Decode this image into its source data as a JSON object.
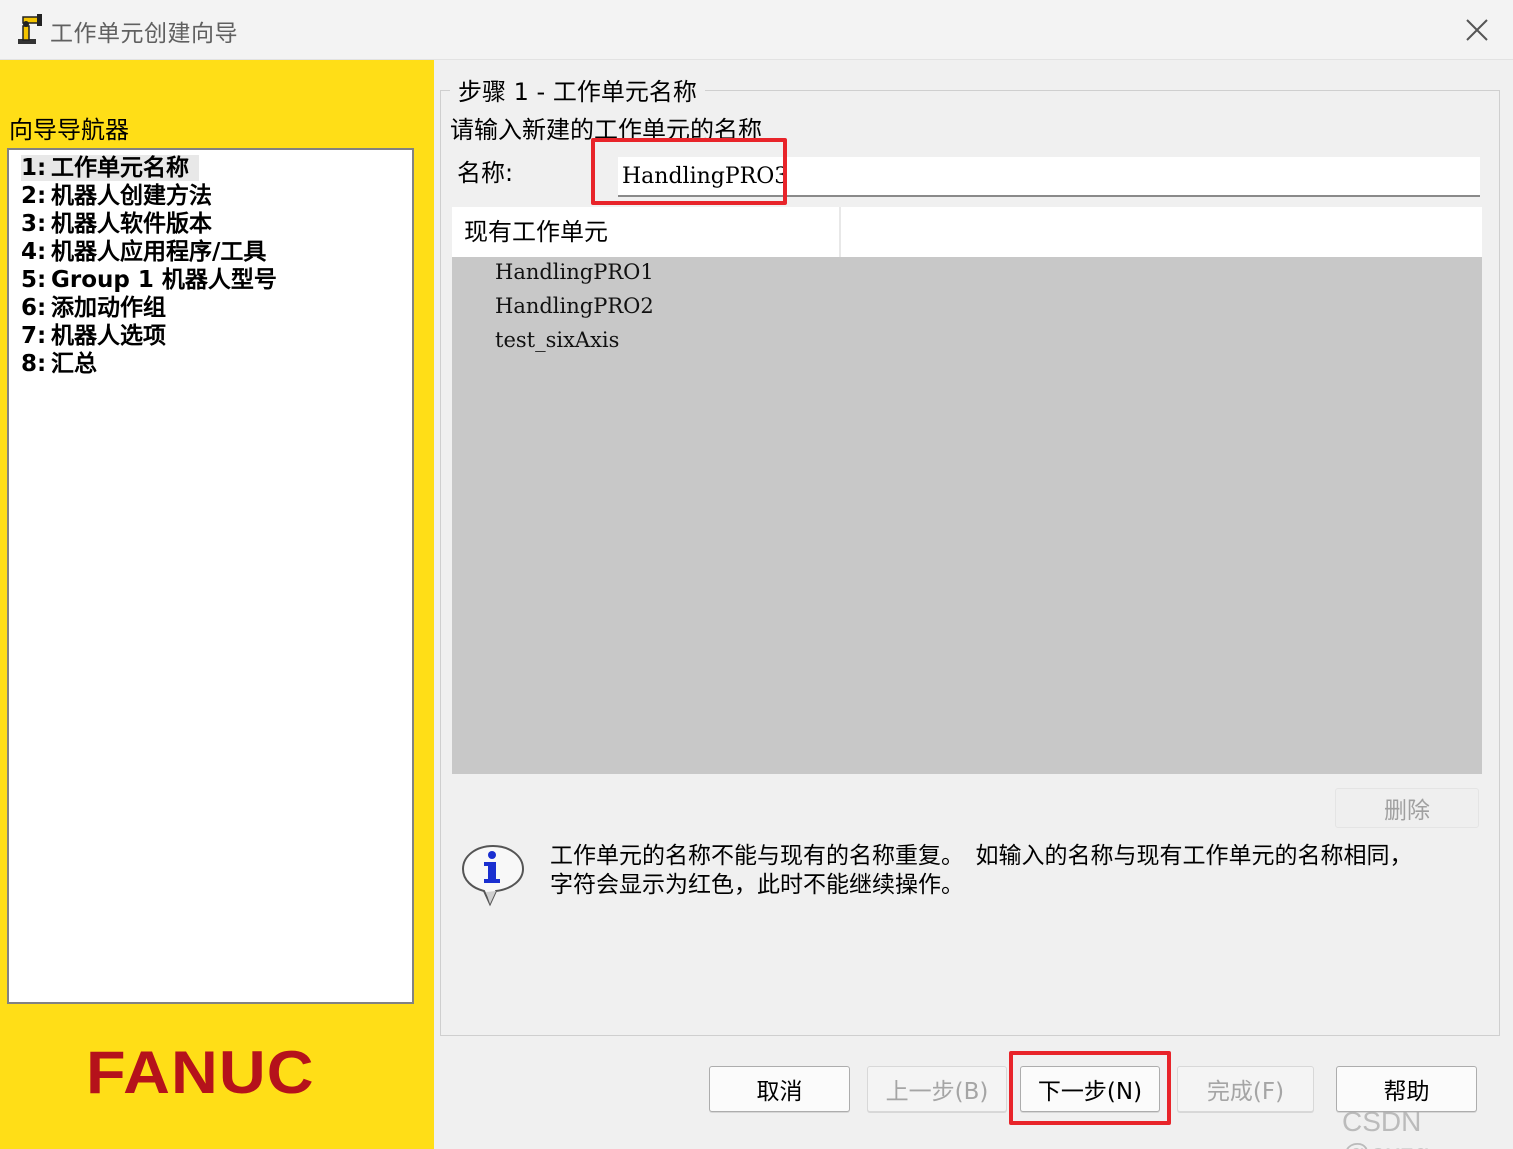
{
  "window": {
    "title": "工作单元创建向导"
  },
  "navigator": {
    "heading": "向导导航器",
    "items": [
      {
        "num": "1:",
        "label": "工作单元名称"
      },
      {
        "num": "2:",
        "label": "机器人创建方法"
      },
      {
        "num": "3:",
        "label": "机器人软件版本"
      },
      {
        "num": "4:",
        "label": "机器人应用程序/工具"
      },
      {
        "num": "5:",
        "label": "Group 1 机器人型号"
      },
      {
        "num": "6:",
        "label": "添加动作组"
      },
      {
        "num": "7:",
        "label": "机器人选项"
      },
      {
        "num": "8:",
        "label": "汇总"
      }
    ],
    "active_index": 0
  },
  "brand": {
    "logo_text": "FANUC",
    "logo_color": "#b5121b",
    "panel_color": "#ffde17"
  },
  "step": {
    "title": "步骤 1 - 工作单元名称",
    "instruction": "请输入新建的工作单元的名称",
    "name_label": "名称:",
    "name_value": "HandlingPRO3"
  },
  "existing": {
    "header": "现有工作单元",
    "items": [
      "HandlingPRO1",
      "HandlingPRO2",
      "test_sixAxis"
    ],
    "delete_label": "删除"
  },
  "info": {
    "text": "工作单元的名称不能与现有的名称重复。　如输入的名称与现有工作单元的名称相同，字符会显示为红色，此时不能继续操作。"
  },
  "buttons": {
    "cancel": "取消",
    "back": "上一步(B)",
    "next": "下一步(N)",
    "finish": "完成(F)",
    "help": "帮助"
  },
  "highlight_color": "#e8242a",
  "watermark": "CSDN @axzg"
}
